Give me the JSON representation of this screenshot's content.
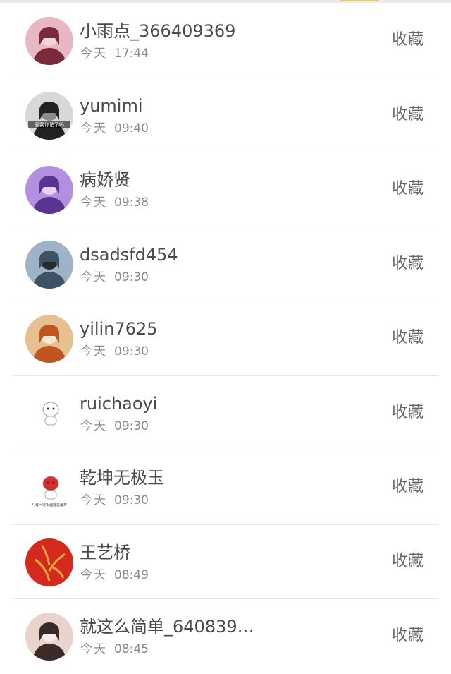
{
  "rows": [
    {
      "name": "小雨点_366409369",
      "day": "今天",
      "time": "17:44",
      "action": "收藏",
      "avatar_icon": "girl-portrait-avatar",
      "colors": [
        "#e7b8c4",
        "#7a2a3a",
        "#f3d6d6"
      ]
    },
    {
      "name": "yumimi",
      "day": "今天",
      "time": "09:40",
      "action": "收藏",
      "avatar_icon": "monochrome-girl-avatar",
      "avatar_caption": "爱我你怕了吗",
      "colors": [
        "#d8d8d8",
        "#222222",
        "#8c8c8c"
      ]
    },
    {
      "name": "病娇贤",
      "day": "今天",
      "time": "09:38",
      "action": "收藏",
      "avatar_icon": "purple-hat-avatar",
      "colors": [
        "#b48fe0",
        "#5a3590",
        "#e6d4f7"
      ]
    },
    {
      "name": "dsadsfd454",
      "day": "今天",
      "time": "09:30",
      "action": "收藏",
      "avatar_icon": "city-girl-avatar",
      "colors": [
        "#9fb3c8",
        "#3e5266",
        "#2a2a2a"
      ]
    },
    {
      "name": "yilin7625",
      "day": "今天",
      "time": "09:30",
      "action": "收藏",
      "avatar_icon": "child-eating-avatar",
      "colors": [
        "#e6c090",
        "#c0561f",
        "#f6e8d4"
      ]
    },
    {
      "name": "ruichaoyi",
      "day": "今天",
      "time": "09:30",
      "action": "收藏",
      "avatar_icon": "cartoon-character-avatar",
      "colors": [
        "#ffffff",
        "#d04040",
        "#555555"
      ]
    },
    {
      "name": "乾坤无极玉",
      "day": "今天",
      "time": "09:30",
      "action": "收藏",
      "avatar_icon": "cartoon-text-avatar",
      "avatar_caption": "我们每一次相遇都是最美的",
      "colors": [
        "#ffffff",
        "#d92b2b",
        "#2b2b2b"
      ]
    },
    {
      "name": "王艺桥",
      "day": "今天",
      "time": "08:49",
      "action": "收藏",
      "avatar_icon": "red-abstract-avatar",
      "colors": [
        "#d42a1e",
        "#f2a43a",
        "#8a120c"
      ]
    },
    {
      "name": "就这么简单_640839…",
      "day": "今天",
      "time": "08:45",
      "action": "收藏",
      "avatar_icon": "long-hair-girl-avatar",
      "colors": [
        "#e8d4cc",
        "#3a2a28",
        "#f6ecea"
      ]
    }
  ]
}
